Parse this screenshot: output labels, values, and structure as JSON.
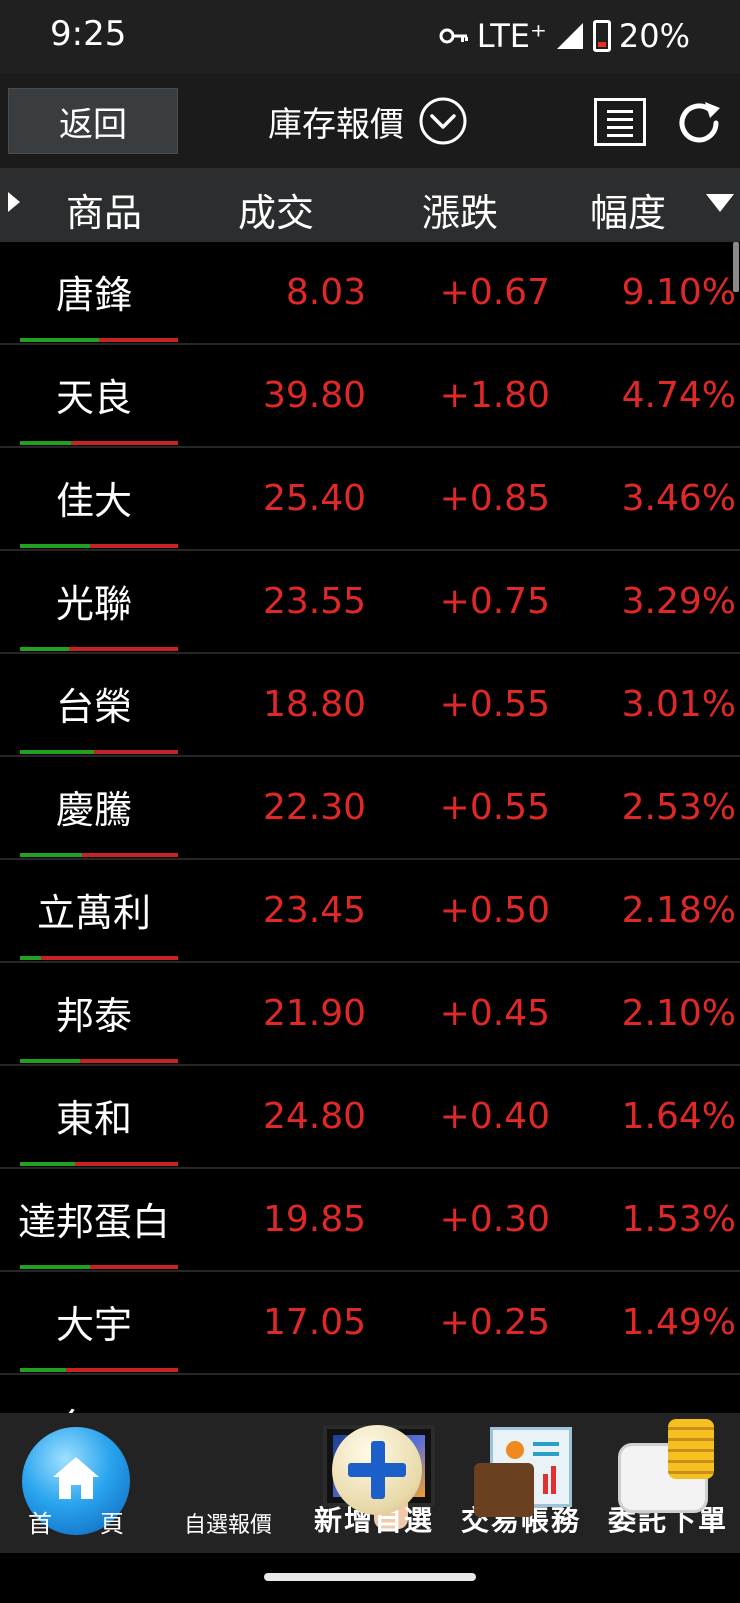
{
  "status_bar": {
    "time": "9:25",
    "network": "LTE⁺",
    "battery": "20%",
    "battery_level": 0.2
  },
  "header": {
    "back_label": "返回",
    "title": "庫存報價"
  },
  "columns": {
    "name": "商品",
    "price": "成交",
    "change": "漲跌",
    "percent": "幅度"
  },
  "rows": [
    {
      "name": "唐鋒",
      "price": "8.03",
      "change": "+0.67",
      "percent": "9.10%",
      "split": 0.5
    },
    {
      "name": "天良",
      "price": "39.80",
      "change": "+1.80",
      "percent": "4.74%",
      "split": 0.32
    },
    {
      "name": "佳大",
      "price": "25.40",
      "change": "+0.85",
      "percent": "3.46%",
      "split": 0.44
    },
    {
      "name": "光聯",
      "price": "23.55",
      "change": "+0.75",
      "percent": "3.29%",
      "split": 0.31
    },
    {
      "name": "台榮",
      "price": "18.80",
      "change": "+0.55",
      "percent": "3.01%",
      "split": 0.47
    },
    {
      "name": "慶騰",
      "price": "22.30",
      "change": "+0.55",
      "percent": "2.53%",
      "split": 0.39
    },
    {
      "name": "立萬利",
      "price": "23.45",
      "change": "+0.50",
      "percent": "2.18%",
      "split": 0.13
    },
    {
      "name": "邦泰",
      "price": "21.90",
      "change": "+0.45",
      "percent": "2.10%",
      "split": 0.38
    },
    {
      "name": "東和",
      "price": "24.80",
      "change": "+0.40",
      "percent": "1.64%",
      "split": 0.35
    },
    {
      "name": "達邦蛋白",
      "price": "19.85",
      "change": "+0.30",
      "percent": "1.53%",
      "split": 0.44
    },
    {
      "name": "大宇",
      "price": "17.05",
      "change": "+0.25",
      "percent": "1.49%",
      "split": 0.29
    },
    {
      "name": "台一",
      "price": "",
      "change": "",
      "percent": "",
      "split": 0.5
    }
  ],
  "bottom_nav": {
    "home": "首　　頁",
    "watchlist": "自選報價",
    "add_watch": "新增自選",
    "account": "交易帳務",
    "order": "委託下單"
  },
  "colors": {
    "up": "#e02828",
    "bar_green": "#22a022",
    "bar_red": "#c62424"
  }
}
